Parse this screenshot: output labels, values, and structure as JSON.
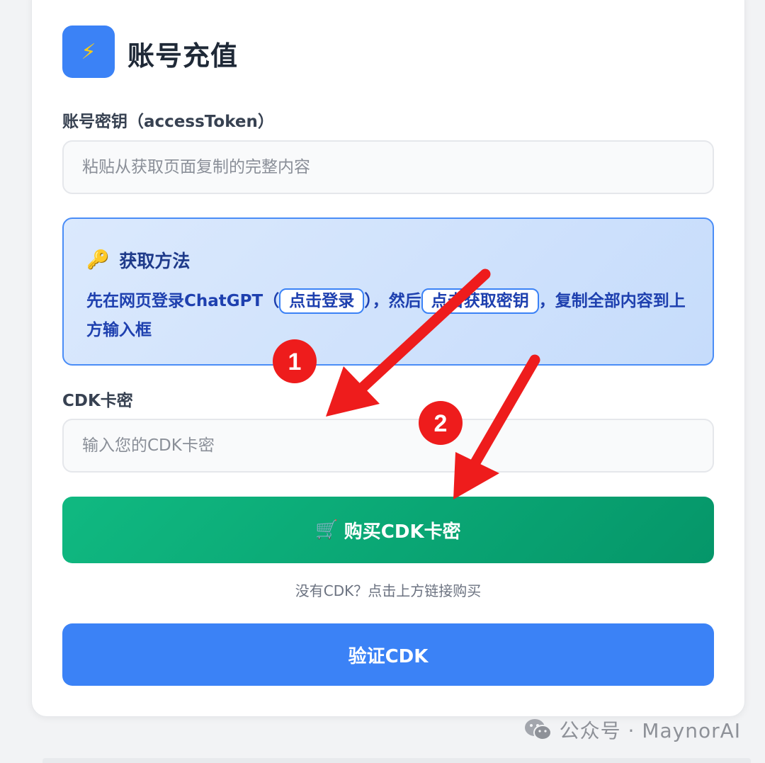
{
  "header": {
    "title": "账号充值",
    "logo_icon": "⚡"
  },
  "access_token": {
    "label": "账号密钥（accessToken）",
    "placeholder": "粘贴从获取页面复制的完整内容",
    "value": ""
  },
  "howto": {
    "title_icon": "🔑",
    "title": "获取方法",
    "text_before": "先在网页登录ChatGPT（",
    "login_link": "点击登录",
    "text_middle": "），然后",
    "get_key_link": "点击获取密钥",
    "text_after": "，复制全部内容到上方输入框"
  },
  "cdk": {
    "label": "CDK卡密",
    "placeholder": "输入您的CDK卡密",
    "value": ""
  },
  "buy_button": {
    "icon": "🛒",
    "label": "购买CDK卡密"
  },
  "hint": "没有CDK？点击上方链接购买",
  "verify_button": {
    "label": "验证CDK"
  },
  "annotations": {
    "marker_1": "1",
    "marker_2": "2",
    "color": "#ee1c1c"
  },
  "watermark": {
    "text": "公众号 · MaynorAI"
  },
  "colors": {
    "primary": "#3b82f6",
    "success": "#10b981",
    "info_bg": "#dbe9fd"
  }
}
